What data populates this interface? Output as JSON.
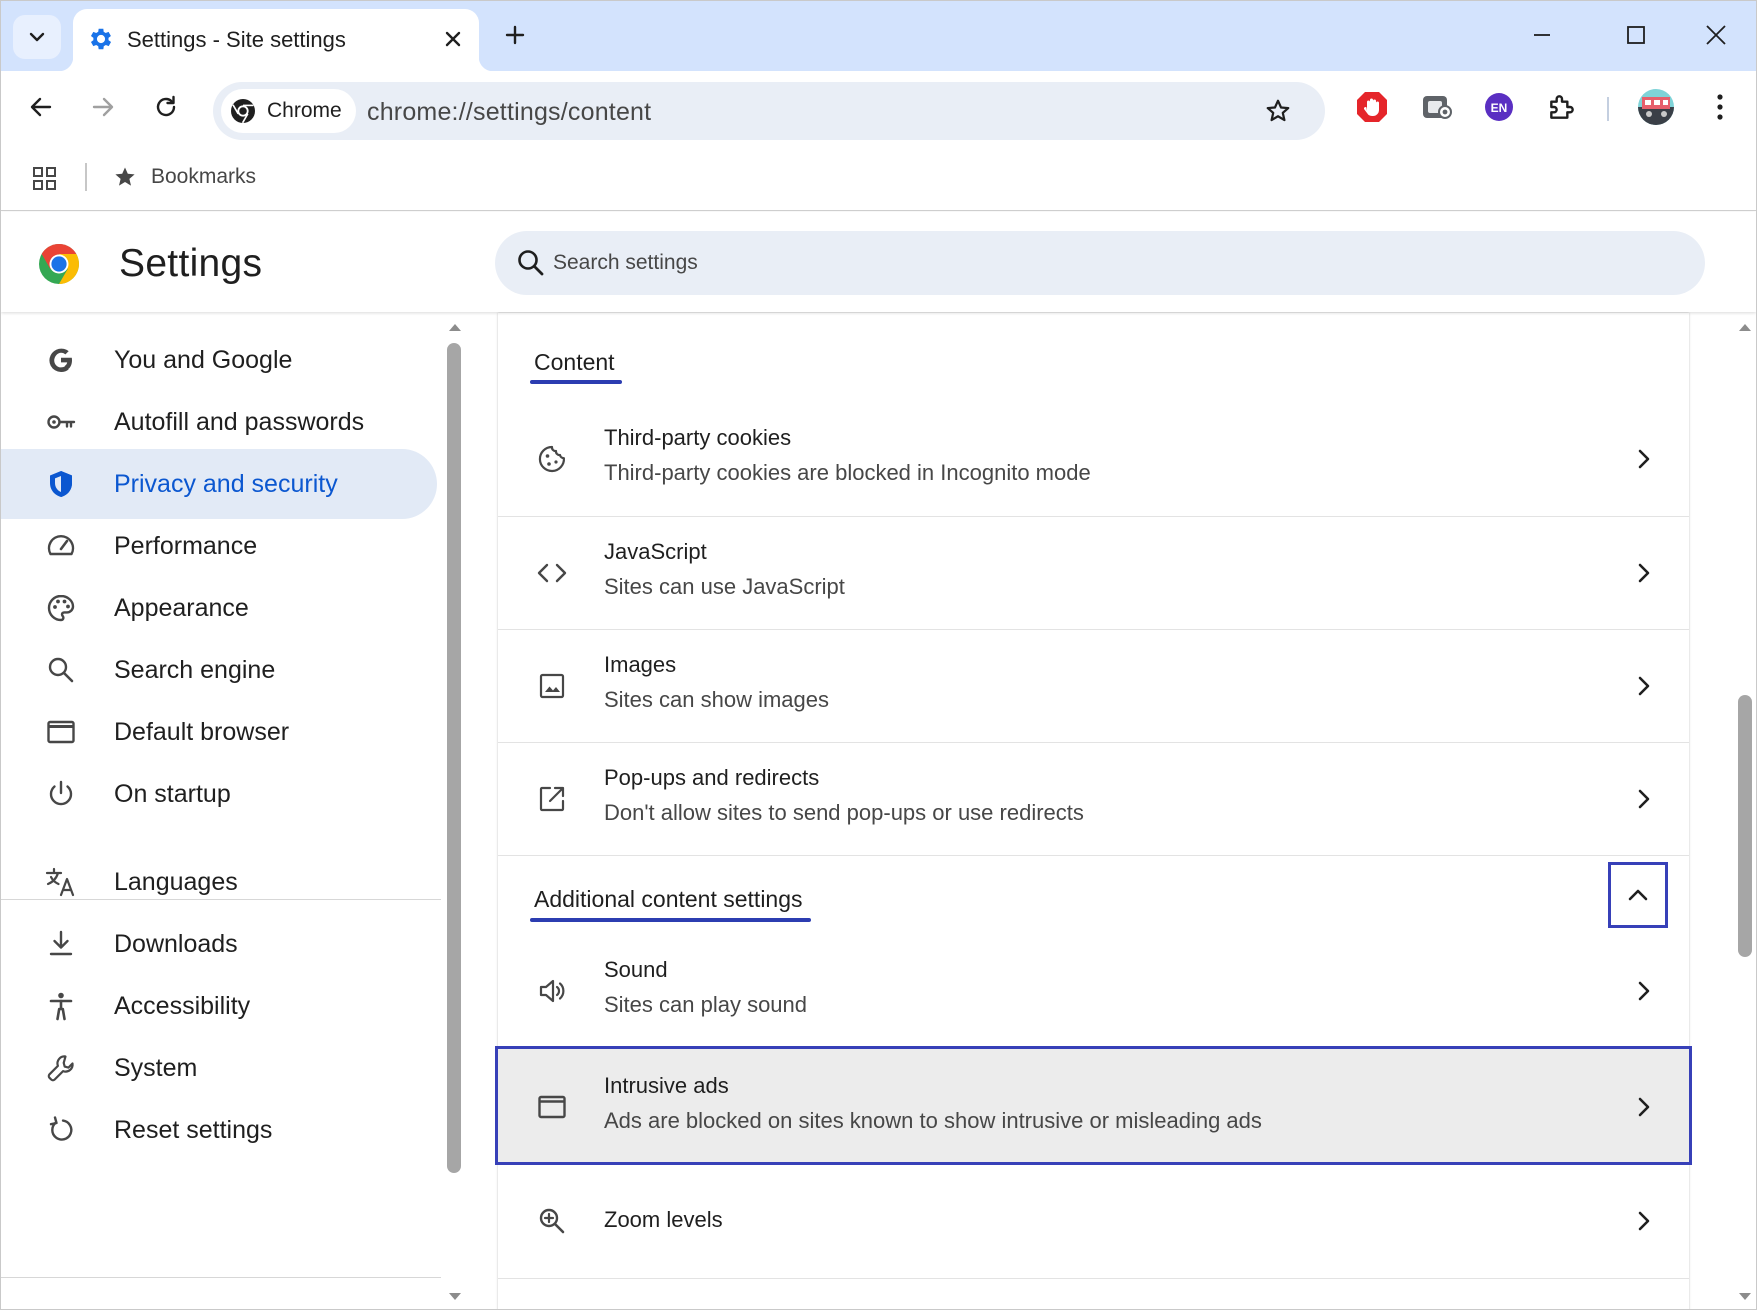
{
  "browser": {
    "tab": {
      "title": "Settings - Site settings",
      "favicon": "gear-icon"
    },
    "omnibox": {
      "chip_label": "Chrome",
      "url": "chrome://settings/content"
    },
    "bookmarks": {
      "folder_label": "Bookmarks"
    },
    "extensions": [
      {
        "name": "adblock-extension-icon",
        "color": "#e5252a"
      },
      {
        "name": "capture-extension-icon",
        "color": "#5f6368"
      },
      {
        "name": "language-extension-icon",
        "label": "EN",
        "color": "#5a2fc2"
      },
      {
        "name": "extensions-puzzle-icon",
        "color": "#1f1f1f"
      }
    ]
  },
  "settings": {
    "title": "Settings",
    "search_placeholder": "Search settings",
    "nav": [
      {
        "id": "you-and-google",
        "label": "You and Google",
        "icon": "google-g-icon",
        "active": false
      },
      {
        "id": "autofill",
        "label": "Autofill and passwords",
        "icon": "key-icon",
        "active": false
      },
      {
        "id": "privacy",
        "label": "Privacy and security",
        "icon": "shield-icon",
        "active": true
      },
      {
        "id": "performance",
        "label": "Performance",
        "icon": "speedometer-icon",
        "active": false
      },
      {
        "id": "appearance",
        "label": "Appearance",
        "icon": "palette-icon",
        "active": false
      },
      {
        "id": "search-engine",
        "label": "Search engine",
        "icon": "search-icon",
        "active": false
      },
      {
        "id": "default-browser",
        "label": "Default browser",
        "icon": "browser-window-icon",
        "active": false
      },
      {
        "id": "on-startup",
        "label": "On startup",
        "icon": "power-icon",
        "active": false
      },
      {
        "id": "languages",
        "label": "Languages",
        "icon": "translate-icon",
        "active": false
      },
      {
        "id": "downloads",
        "label": "Downloads",
        "icon": "download-icon",
        "active": false
      },
      {
        "id": "accessibility",
        "label": "Accessibility",
        "icon": "accessibility-icon",
        "active": false
      },
      {
        "id": "system",
        "label": "System",
        "icon": "wrench-icon",
        "active": false
      },
      {
        "id": "reset",
        "label": "Reset settings",
        "icon": "reset-icon",
        "active": false
      }
    ]
  },
  "content": {
    "section_title": "Content",
    "items": [
      {
        "title": "Third-party cookies",
        "subtitle": "Third-party cookies are blocked in Incognito mode",
        "icon": "cookie-icon"
      },
      {
        "title": "JavaScript",
        "subtitle": "Sites can use JavaScript",
        "icon": "code-icon"
      },
      {
        "title": "Images",
        "subtitle": "Sites can show images",
        "icon": "image-icon"
      },
      {
        "title": "Pop-ups and redirects",
        "subtitle": "Don't allow sites to send pop-ups or use redirects",
        "icon": "open-in-new-icon"
      }
    ],
    "additional_title": "Additional content settings",
    "additional_expanded": true,
    "additional_items": [
      {
        "title": "Sound",
        "subtitle": "Sites can play sound",
        "icon": "speaker-icon",
        "highlighted": false
      },
      {
        "title": "Intrusive ads",
        "subtitle": "Ads are blocked on sites known to show intrusive or misleading ads",
        "icon": "ad-window-icon",
        "highlighted": true
      },
      {
        "title": "Zoom levels",
        "subtitle": "",
        "icon": "zoom-in-icon",
        "highlighted": false
      }
    ]
  },
  "colors": {
    "accent_blue": "#0b57d0",
    "highlight_border": "#3740b8",
    "tabstrip": "#d3e3fd",
    "active_nav_bg": "#e2eaf6"
  }
}
